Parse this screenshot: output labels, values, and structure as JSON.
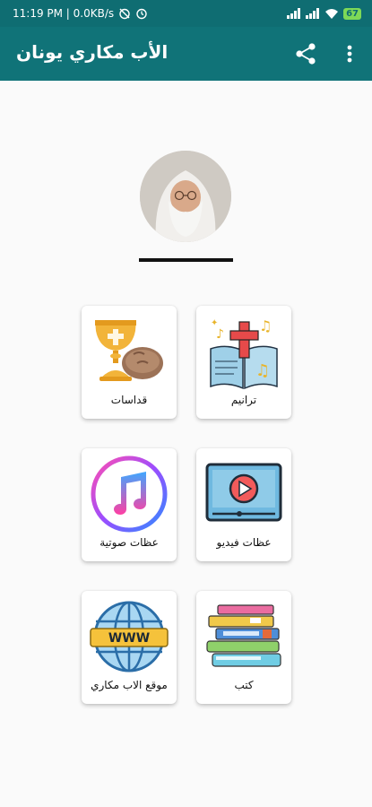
{
  "status_bar": {
    "time_and_speed": "11:19 PM | 0.0KB/s",
    "battery": "67"
  },
  "app_bar": {
    "title": "الأب مكاري يونان"
  },
  "menu": {
    "items": [
      {
        "label": "قداسات",
        "icon": "chalice-bread-icon"
      },
      {
        "label": "ترانيم",
        "icon": "hymn-book-icon"
      },
      {
        "label": "عظات صوتية",
        "icon": "music-note-icon"
      },
      {
        "label": "عظات فيديو",
        "icon": "video-player-icon"
      },
      {
        "label": "موقع الاب مكاري",
        "icon": "www-globe-icon"
      },
      {
        "label": "كتب",
        "icon": "books-stack-icon"
      }
    ]
  },
  "colors": {
    "app_bar": "#107378",
    "status_bar": "#0f6d72"
  }
}
